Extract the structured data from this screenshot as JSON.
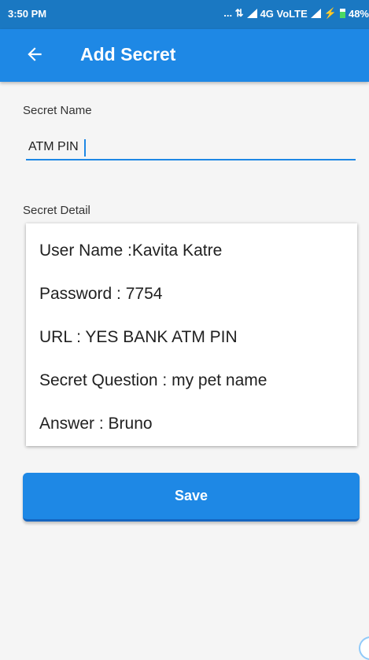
{
  "status_bar": {
    "time": "3:50 PM",
    "indicators": "... ⇅",
    "network": "4G VoLTE",
    "battery": "48%"
  },
  "app_bar": {
    "title": "Add Secret",
    "back_icon": "arrow-left-icon"
  },
  "form": {
    "secret_name_label": "Secret Name",
    "secret_name_value": "ATM PIN",
    "secret_detail_label": "Secret Detail",
    "detail_lines": [
      "User Name :Kavita Katre",
      "Password : 7754",
      "URL : YES BANK ATM PIN",
      "Secret Question : my pet name",
      "Answer : Bruno"
    ],
    "save_label": "Save"
  },
  "colors": {
    "status_bar": "#1a78c2",
    "primary": "#1e88e5",
    "background": "#f5f5f5"
  }
}
